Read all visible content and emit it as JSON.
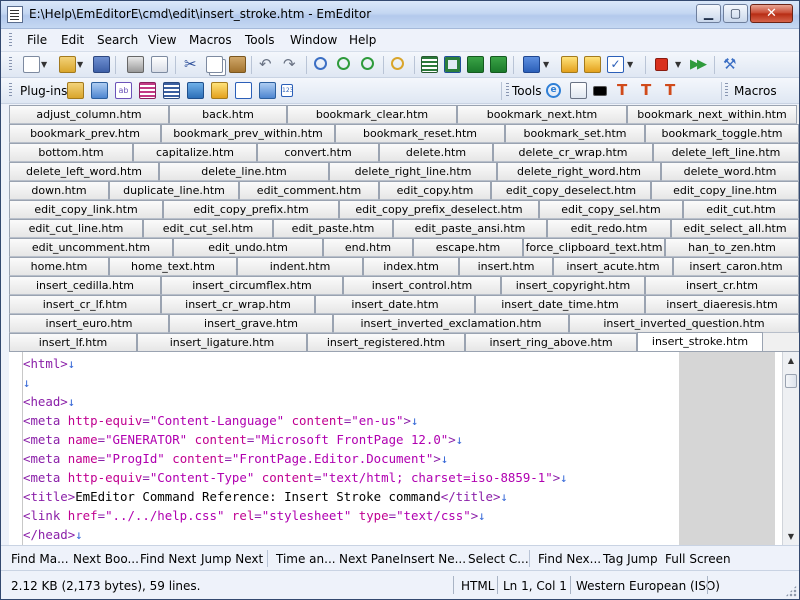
{
  "window": {
    "title": "E:\\Help\\EmEditorE\\cmd\\edit\\insert_stroke.htm - EmEditor",
    "controls": {
      "minimize": "▁",
      "maximize": "▢",
      "close": "✕"
    }
  },
  "menu": [
    "File",
    "Edit",
    "Search",
    "View",
    "Macros",
    "Tools",
    "Window",
    "Help"
  ],
  "toolbars": {
    "plugins_label": "Plug-ins",
    "tools_label": "Tools",
    "macros_label": "Macros"
  },
  "tabs": [
    [
      "adjust_column.htm",
      "back.htm",
      "bookmark_clear.htm",
      "bookmark_next.htm",
      "bookmark_next_within.htm"
    ],
    [
      "bookmark_prev.htm",
      "bookmark_prev_within.htm",
      "bookmark_reset.htm",
      "bookmark_set.htm",
      "bookmark_toggle.htm"
    ],
    [
      "bottom.htm",
      "capitalize.htm",
      "convert.htm",
      "delete.htm",
      "delete_cr_wrap.htm",
      "delete_left_line.htm"
    ],
    [
      "delete_left_word.htm",
      "delete_line.htm",
      "delete_right_line.htm",
      "delete_right_word.htm",
      "delete_word.htm"
    ],
    [
      "down.htm",
      "duplicate_line.htm",
      "edit_comment.htm",
      "edit_copy.htm",
      "edit_copy_deselect.htm",
      "edit_copy_line.htm"
    ],
    [
      "edit_copy_link.htm",
      "edit_copy_prefix.htm",
      "edit_copy_prefix_deselect.htm",
      "edit_copy_sel.htm",
      "edit_cut.htm"
    ],
    [
      "edit_cut_line.htm",
      "edit_cut_sel.htm",
      "edit_paste.htm",
      "edit_paste_ansi.htm",
      "edit_redo.htm",
      "edit_select_all.htm"
    ],
    [
      "edit_uncomment.htm",
      "edit_undo.htm",
      "end.htm",
      "escape.htm",
      "force_clipboard_text.htm",
      "han_to_zen.htm"
    ],
    [
      "home.htm",
      "home_text.htm",
      "indent.htm",
      "index.htm",
      "insert.htm",
      "insert_acute.htm",
      "insert_caron.htm"
    ],
    [
      "insert_cedilla.htm",
      "insert_circumflex.htm",
      "insert_control.htm",
      "insert_copyright.htm",
      "insert_cr.htm"
    ],
    [
      "insert_cr_lf.htm",
      "insert_cr_wrap.htm",
      "insert_date.htm",
      "insert_date_time.htm",
      "insert_diaeresis.htm"
    ],
    [
      "insert_euro.htm",
      "insert_grave.htm",
      "insert_inverted_exclamation.htm",
      "insert_inverted_question.htm"
    ],
    [
      "insert_lf.htm",
      "insert_ligature.htm",
      "insert_registered.htm",
      "insert_ring_above.htm",
      "insert_stroke.htm"
    ]
  ],
  "active_tab": "insert_stroke.htm",
  "editor": {
    "lines": [
      [
        [
          "tag",
          "<html>"
        ],
        [
          "eol",
          "↓"
        ]
      ],
      [
        [
          "eol",
          "↓"
        ]
      ],
      [
        [
          "tag",
          "<head>"
        ],
        [
          "eol",
          "↓"
        ]
      ],
      [
        [
          "tag",
          "<meta "
        ],
        [
          "attr",
          "http-equiv"
        ],
        [
          "tag",
          "="
        ],
        [
          "str",
          "\"Content-Language\""
        ],
        [
          "tag",
          " "
        ],
        [
          "attr",
          "content"
        ],
        [
          "tag",
          "="
        ],
        [
          "str",
          "\"en-us\""
        ],
        [
          "tag",
          ">"
        ],
        [
          "eol",
          "↓"
        ]
      ],
      [
        [
          "tag",
          "<meta "
        ],
        [
          "attr",
          "name"
        ],
        [
          "tag",
          "="
        ],
        [
          "str",
          "\"GENERATOR\""
        ],
        [
          "tag",
          " "
        ],
        [
          "attr",
          "content"
        ],
        [
          "tag",
          "="
        ],
        [
          "str",
          "\"Microsoft FrontPage 12.0\""
        ],
        [
          "tag",
          ">"
        ],
        [
          "eol",
          "↓"
        ]
      ],
      [
        [
          "tag",
          "<meta "
        ],
        [
          "attr",
          "name"
        ],
        [
          "tag",
          "="
        ],
        [
          "str",
          "\"ProgId\""
        ],
        [
          "tag",
          " "
        ],
        [
          "attr",
          "content"
        ],
        [
          "tag",
          "="
        ],
        [
          "str",
          "\"FrontPage.Editor.Document\""
        ],
        [
          "tag",
          ">"
        ],
        [
          "eol",
          "↓"
        ]
      ],
      [
        [
          "tag",
          "<meta "
        ],
        [
          "attr",
          "http-equiv"
        ],
        [
          "tag",
          "="
        ],
        [
          "str",
          "\"Content-Type\""
        ],
        [
          "tag",
          " "
        ],
        [
          "attr",
          "content"
        ],
        [
          "tag",
          "="
        ],
        [
          "str",
          "\"text/html; charset=iso-8859-1\""
        ],
        [
          "tag",
          ">"
        ],
        [
          "eol",
          "↓"
        ]
      ],
      [
        [
          "tag",
          "<title>"
        ],
        [
          "txt",
          "EmEditor Command Reference: Insert Stroke command"
        ],
        [
          "tag",
          "</title>"
        ],
        [
          "eol",
          "↓"
        ]
      ],
      [
        [
          "tag",
          "<link "
        ],
        [
          "attr",
          "href"
        ],
        [
          "tag",
          "="
        ],
        [
          "str",
          "\"../../help.css\""
        ],
        [
          "tag",
          " "
        ],
        [
          "attr",
          "rel"
        ],
        [
          "tag",
          "="
        ],
        [
          "str",
          "\"stylesheet\""
        ],
        [
          "tag",
          " "
        ],
        [
          "attr",
          "type"
        ],
        [
          "tag",
          "="
        ],
        [
          "str",
          "\"text/css\""
        ],
        [
          "tag",
          ">"
        ],
        [
          "eol",
          "↓"
        ]
      ],
      [
        [
          "tag",
          "</head>"
        ],
        [
          "eol",
          "↓"
        ]
      ]
    ]
  },
  "function_keys": [
    [
      "Find Ma...",
      "Next Boo...",
      "Find Next",
      "Jump Next"
    ],
    [
      "Time an...",
      "Next Pane",
      "Insert Ne...",
      "Select C..."
    ],
    [
      "Find Nex...",
      "Tag Jump",
      "Full Screen"
    ]
  ],
  "status": {
    "file_info": "2.12 KB (2,173 bytes), 59 lines.",
    "mode": "HTML",
    "position": "Ln 1, Col 1",
    "encoding": "Western European (ISO)"
  },
  "icons": {
    "standard": [
      "new-file-icon",
      "dropdown-icon",
      "open-icon",
      "dropdown-icon",
      "save-icon",
      "print-icon",
      "print-preview-icon",
      "cut-icon",
      "copy-icon",
      "paste-icon",
      "undo-icon",
      "redo-icon",
      "find-icon",
      "find-next-icon",
      "find-prev-icon",
      "find-in-files-icon",
      "word-wrap-icon",
      "wrap-window-icon",
      "wrap-page-icon",
      "wrap-none-icon",
      "config-icon",
      "dropdown-icon",
      "customize-icon",
      "properties-icon",
      "checklist-icon",
      "dropdown-icon",
      "record-macro-icon",
      "dropdown-icon",
      "run-macro-icon",
      "plugins-settings-icon"
    ],
    "plugins": [
      "projects-icon",
      "outline-icon",
      "char-code-icon",
      "html-bar-icon",
      "snippets-icon",
      "web-preview-icon",
      "explorer-icon",
      "find-bar-icon",
      "word-complete-icon",
      "word-count-icon"
    ],
    "tools": [
      "ie-icon",
      "notepad-icon",
      "command-prompt-icon",
      "pin-icon",
      "pin-icon",
      "pin-icon"
    ]
  },
  "colors": {
    "tag": "#8a1fa8",
    "attribute": "#c00090",
    "string": "#b000b0",
    "eol_mark": "#3a6bd8",
    "window_border": "#33496f"
  }
}
